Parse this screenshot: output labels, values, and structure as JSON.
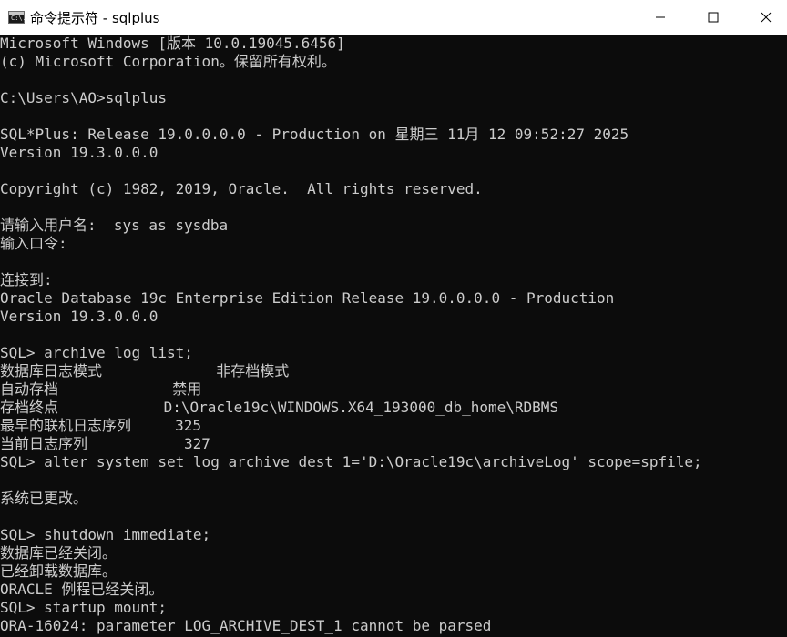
{
  "window": {
    "title": "命令提示符 - sqlplus",
    "icon": "cmd-icon",
    "icon_glyph": "C:\\.",
    "controls": [
      "minimize",
      "maximize",
      "close"
    ]
  },
  "console": {
    "lines": [
      "Microsoft Windows [版本 10.0.19045.6456]",
      "(c) Microsoft Corporation。保留所有权利。",
      "",
      "C:\\Users\\AO>sqlplus",
      "",
      "SQL*Plus: Release 19.0.0.0.0 - Production on 星期三 11月 12 09:52:27 2025",
      "Version 19.3.0.0.0",
      "",
      "Copyright (c) 1982, 2019, Oracle.  All rights reserved.",
      "",
      "请输入用户名:  sys as sysdba",
      "输入口令:",
      "",
      "连接到:",
      "Oracle Database 19c Enterprise Edition Release 19.0.0.0.0 - Production",
      "Version 19.3.0.0.0",
      "",
      "SQL> archive log list;",
      "数据库日志模式             非存档模式",
      "自动存档             禁用",
      "存档终点            D:\\Oracle19c\\WINDOWS.X64_193000_db_home\\RDBMS",
      "最早的联机日志序列     325",
      "当前日志序列           327",
      "SQL> alter system set log_archive_dest_1='D:\\Oracle19c\\archiveLog' scope=spfile;",
      "",
      "系统已更改。",
      "",
      "SQL> shutdown immediate;",
      "数据库已经关闭。",
      "已经卸载数据库。",
      "ORACLE 例程已经关闭。",
      "SQL> startup mount;",
      "ORA-16024: parameter LOG_ARCHIVE_DEST_1 cannot be parsed"
    ]
  },
  "colors": {
    "console_bg": "#0c0c0c",
    "console_fg": "#cccccc",
    "titlebar_bg": "#ffffff"
  }
}
